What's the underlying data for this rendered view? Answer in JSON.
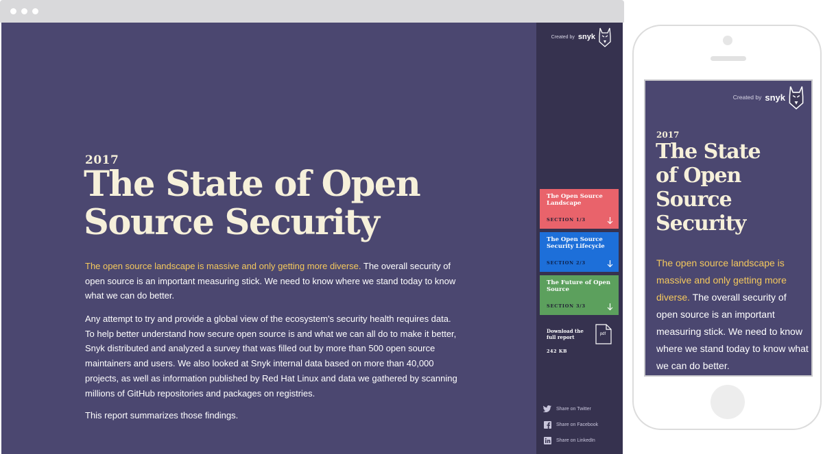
{
  "hero": {
    "year": "2017",
    "title_line1": "The State of Open",
    "title_line2": "Source Security",
    "highlight": "The open source landscape is massive and only getting more diverse.",
    "intro_rest": " The overall security of open source is an important measuring stick. We need to know where we stand today to know what we can do better.",
    "paragraph2": "Any attempt to try and provide a global view of the ecosystem's security health requires data. To help better understand how secure open source is and what we can all do to make it better, Snyk distributed and analyzed a survey that was filled out by more than 500 open source maintainers and users. We also looked at Snyk internal data based on more than 40,000 projects, as well as information published by Red Hat Linux and data we gathered by scanning millions of GitHub repositories and packages on registries.",
    "paragraph3": "This report summarizes those findings."
  },
  "brand": {
    "created_by": "Created by",
    "name": "snyk",
    "logo_icon": "snyk-dog-icon"
  },
  "sections": [
    {
      "title": "The Open Source Landscape",
      "label": "SECTION 1/3",
      "color": "#e9636b",
      "icon": "arrow-down-icon"
    },
    {
      "title": "The Open Source Security Lifecycle",
      "label": "SECTION 2/3",
      "color": "#1d6fd9",
      "icon": "arrow-down-icon"
    },
    {
      "title": "The Future of Open Source",
      "label": "SECTION 3/3",
      "color": "#5ca05d",
      "icon": "arrow-down-icon"
    }
  ],
  "download": {
    "label": "Download the full report",
    "size": "242 KB",
    "icon_text": "pdf",
    "icon": "pdf-file-icon"
  },
  "share": [
    {
      "label": "Share on Twitter",
      "icon": "twitter-icon"
    },
    {
      "label": "Share on Facebook",
      "icon": "facebook-icon"
    },
    {
      "label": "Share on LinkedIn",
      "icon": "linkedin-icon"
    }
  ],
  "mobile": {
    "title_lines": [
      "The State",
      "of Open",
      "Source",
      "Security"
    ]
  },
  "colors": {
    "page_bg": "#4b4770",
    "sidebar_bg": "#36324f",
    "headline": "#f6f0da",
    "highlight": "#f5c95d"
  }
}
